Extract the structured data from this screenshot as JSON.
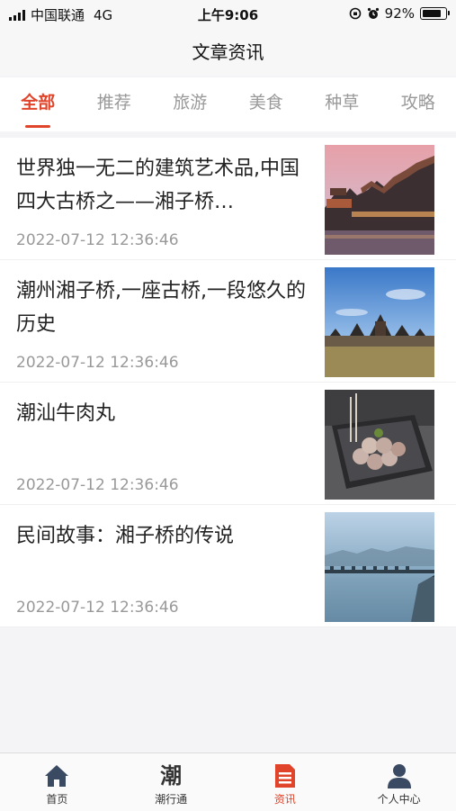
{
  "status": {
    "carrier": "中国联通",
    "network": "4G",
    "time": "上午9:06",
    "battery_percent": "92%",
    "battery_level": 0.92
  },
  "nav": {
    "title": "文章资讯"
  },
  "tabs": [
    {
      "label": "全部",
      "active": true
    },
    {
      "label": "推荐",
      "active": false
    },
    {
      "label": "旅游",
      "active": false
    },
    {
      "label": "美食",
      "active": false
    },
    {
      "label": "种草",
      "active": false
    },
    {
      "label": "攻略",
      "active": false
    }
  ],
  "articles": [
    {
      "title": "世界独一无二的建筑艺术品,中国四大古桥之——湘子桥…",
      "date": "2022-07-12 12:36:46",
      "image": "ancient-bridge-sunset"
    },
    {
      "title": "潮州湘子桥,一座古桥,一段悠久的历史",
      "date": "2022-07-12 12:36:46",
      "image": "bridge-pavilions-blue-sky"
    },
    {
      "title": "潮汕牛肉丸",
      "date": "2022-07-12 12:36:46",
      "image": "beef-balls-plate"
    },
    {
      "title": "民间故事：湘子桥的传说",
      "date": "2022-07-12 12:36:46",
      "image": "bridge-over-river"
    }
  ],
  "tabbar": {
    "items": [
      {
        "label": "首页",
        "icon": "home-icon",
        "active": false
      },
      {
        "label": "潮行通",
        "icon_char": "潮",
        "active": false
      },
      {
        "label": "资讯",
        "icon": "document-icon",
        "active": true
      },
      {
        "label": "个人中心",
        "icon": "person-icon",
        "active": false
      }
    ]
  },
  "colors": {
    "accent": "#e0452b",
    "muted": "#999999",
    "tab_icon": "#3a4a63"
  }
}
